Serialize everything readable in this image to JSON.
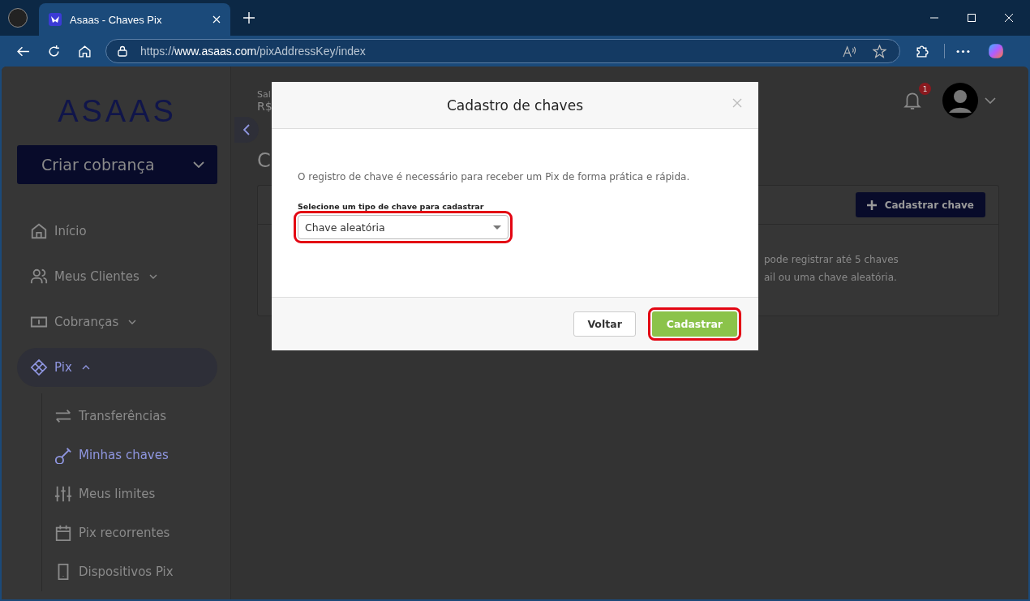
{
  "browser": {
    "tab_title": "Asaas - Chaves Pix",
    "url_scheme": "https://",
    "url_host": "www.asaas.com",
    "url_path": "/pixAddressKey/index"
  },
  "sidebar": {
    "logo_text": "ASAAS",
    "create_button": "Criar cobrança",
    "items": [
      {
        "kind": "home",
        "label": "Início",
        "selected": false
      },
      {
        "kind": "users",
        "label": "Meus Clientes",
        "selected": false,
        "expanded": false
      },
      {
        "kind": "money",
        "label": "Cobranças",
        "selected": false,
        "expanded": false
      },
      {
        "kind": "pix",
        "label": "Pix",
        "selected": true,
        "expanded": true,
        "children": [
          {
            "kind": "transfer",
            "label": "Transferências",
            "selected": false
          },
          {
            "kind": "key",
            "label": "Minhas chaves",
            "selected": true
          },
          {
            "kind": "sliders",
            "label": "Meus limites",
            "selected": false
          },
          {
            "kind": "calendar",
            "label": "Pix recorrentes",
            "selected": false
          },
          {
            "kind": "phone",
            "label": "Dispositivos Pix",
            "selected": false
          }
        ]
      }
    ]
  },
  "header": {
    "balance_label": "Sal",
    "balance_value": "R$",
    "notification_count": "1"
  },
  "page_title": "C",
  "card": {
    "add_button": "Cadastrar chave",
    "info_lines": [
      "pode registrar até 5 chaves",
      "ail ou uma chave aleatória."
    ]
  },
  "modal": {
    "title": "Cadastro de chaves",
    "description": "O registro de chave é necessário para receber um Pix de forma prática e rápida.",
    "field_label": "Selecione um tipo de chave para cadastrar",
    "select_value": "Chave aleatória",
    "buttons": [
      {
        "kind": "secondary",
        "label": "Voltar"
      },
      {
        "kind": "primary",
        "label": "Cadastrar"
      }
    ]
  }
}
